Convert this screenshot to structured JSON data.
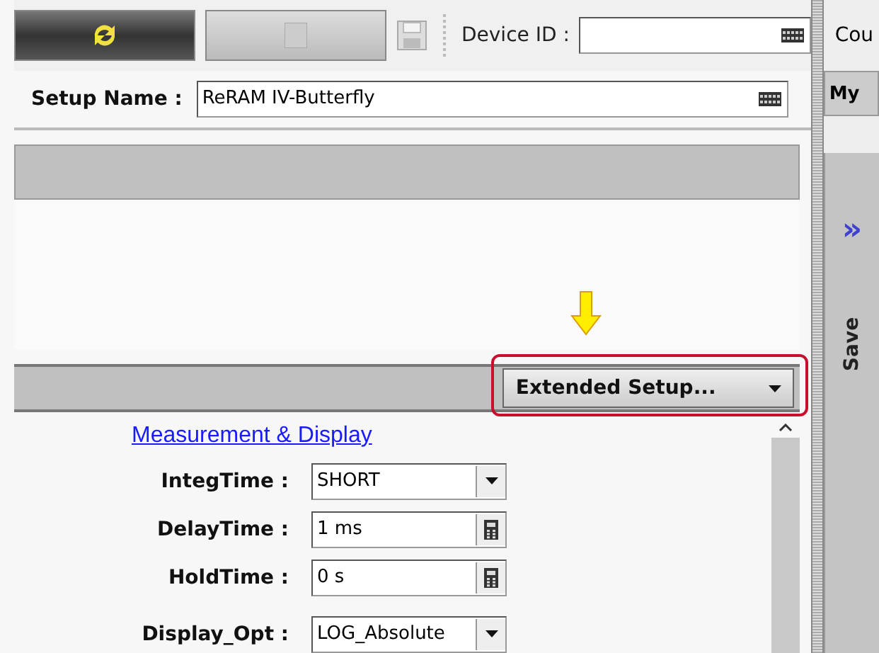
{
  "toolbar": {
    "run_button": {
      "disabled": false
    },
    "stop_button": {
      "disabled": true
    },
    "device_id": {
      "label": "Device ID :"
    },
    "cut_label": "Cou"
  },
  "setup_name": {
    "label": "Setup Name :",
    "value": "ReRAM IV-Butterfly"
  },
  "extended_setup": {
    "label": "Extended Setup..."
  },
  "section_link": "Measurement & Display",
  "fields": [
    {
      "label": "IntegTime :",
      "value": "SHORT",
      "kind": "dropdown"
    },
    {
      "label": "DelayTime :",
      "value": "1 ms",
      "kind": "calculator"
    },
    {
      "label": "HoldTime :",
      "value": "0 s",
      "kind": "calculator"
    },
    {
      "label": "Display_Opt :",
      "value": "LOG_Absolute",
      "kind": "dropdown"
    }
  ],
  "side_panel": {
    "tab": "My",
    "save_label": "Save",
    "expand": "»"
  }
}
